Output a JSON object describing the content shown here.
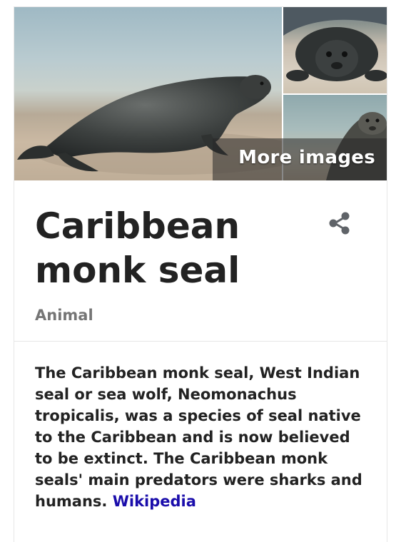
{
  "images": {
    "more_label": "More images"
  },
  "entity": {
    "title": "Caribbean monk seal",
    "type": "Animal"
  },
  "description": {
    "text": "The Caribbean monk seal, West Indian seal or sea wolf, Neomonachus tropicalis, was a species of seal native to the Caribbean and is now believed to be extinct. The Caribbean monk seals' main predators were sharks and humans.",
    "source": "Wikipedia"
  },
  "actions": {
    "share_icon": "share-icon"
  },
  "colors": {
    "link": "#1a0dab",
    "title": "#222222",
    "subtitle": "#757575"
  }
}
